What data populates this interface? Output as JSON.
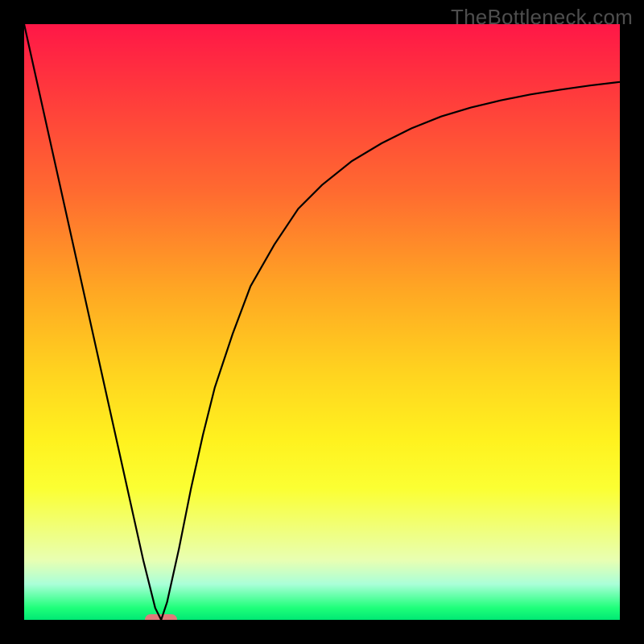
{
  "watermark": "TheBottleneck.com",
  "colors": {
    "frame_bg": "#000000",
    "curve": "#000000",
    "marker": "#e07a7a",
    "watermark": "#4e4e4e"
  },
  "chart_data": {
    "type": "line",
    "title": "",
    "xlabel": "",
    "ylabel": "",
    "xlim": [
      0,
      100
    ],
    "ylim": [
      0,
      100
    ],
    "x": [
      0,
      2,
      4,
      6,
      8,
      10,
      12,
      14,
      16,
      18,
      20,
      22,
      23,
      24,
      26,
      28,
      30,
      32,
      35,
      38,
      42,
      46,
      50,
      55,
      60,
      65,
      70,
      75,
      80,
      85,
      90,
      95,
      100
    ],
    "y": [
      100,
      91,
      82,
      73,
      64,
      55,
      46,
      37,
      28,
      19,
      10,
      2,
      0,
      3,
      12,
      22,
      31,
      39,
      48,
      56,
      63,
      69,
      73,
      77,
      80,
      82.5,
      84.5,
      86,
      87.2,
      88.2,
      89,
      89.7,
      90.3
    ],
    "marker": {
      "x": 23,
      "y": 0
    },
    "note": "V-shaped bottleneck curve: steep linear descent from 100 to 0 at x≈23, then asymptotic rise toward ~90. Background gradient encodes bottleneck severity (red=high, green=low). Axes unlabeled; values estimated from pixel positions."
  }
}
